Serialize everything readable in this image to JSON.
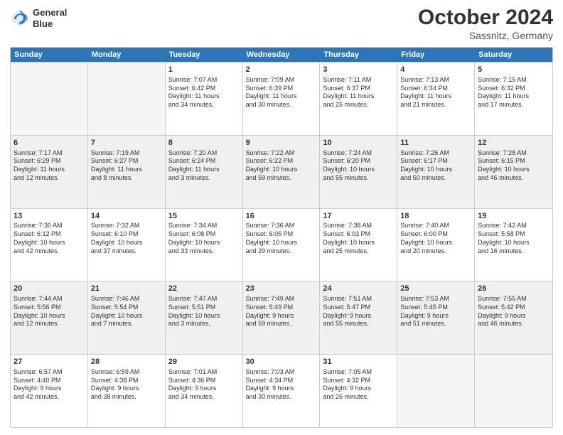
{
  "header": {
    "logo_line1": "General",
    "logo_line2": "Blue",
    "month": "October 2024",
    "location": "Sassnitz, Germany"
  },
  "weekdays": [
    "Sunday",
    "Monday",
    "Tuesday",
    "Wednesday",
    "Thursday",
    "Friday",
    "Saturday"
  ],
  "rows": [
    [
      {
        "day": "",
        "text": "",
        "empty": true
      },
      {
        "day": "",
        "text": "",
        "empty": true
      },
      {
        "day": "1",
        "text": "Sunrise: 7:07 AM\nSunset: 6:42 PM\nDaylight: 11 hours\nand 34 minutes."
      },
      {
        "day": "2",
        "text": "Sunrise: 7:09 AM\nSunset: 6:39 PM\nDaylight: 11 hours\nand 30 minutes."
      },
      {
        "day": "3",
        "text": "Sunrise: 7:11 AM\nSunset: 6:37 PM\nDaylight: 11 hours\nand 25 minutes."
      },
      {
        "day": "4",
        "text": "Sunrise: 7:13 AM\nSunset: 6:34 PM\nDaylight: 11 hours\nand 21 minutes."
      },
      {
        "day": "5",
        "text": "Sunrise: 7:15 AM\nSunset: 6:32 PM\nDaylight: 11 hours\nand 17 minutes."
      }
    ],
    [
      {
        "day": "6",
        "text": "Sunrise: 7:17 AM\nSunset: 6:29 PM\nDaylight: 11 hours\nand 12 minutes.",
        "shaded": true
      },
      {
        "day": "7",
        "text": "Sunrise: 7:19 AM\nSunset: 6:27 PM\nDaylight: 11 hours\nand 8 minutes.",
        "shaded": true
      },
      {
        "day": "8",
        "text": "Sunrise: 7:20 AM\nSunset: 6:24 PM\nDaylight: 11 hours\nand 3 minutes.",
        "shaded": true
      },
      {
        "day": "9",
        "text": "Sunrise: 7:22 AM\nSunset: 6:22 PM\nDaylight: 10 hours\nand 59 minutes.",
        "shaded": true
      },
      {
        "day": "10",
        "text": "Sunrise: 7:24 AM\nSunset: 6:20 PM\nDaylight: 10 hours\nand 55 minutes.",
        "shaded": true
      },
      {
        "day": "11",
        "text": "Sunrise: 7:26 AM\nSunset: 6:17 PM\nDaylight: 10 hours\nand 50 minutes.",
        "shaded": true
      },
      {
        "day": "12",
        "text": "Sunrise: 7:28 AM\nSunset: 6:15 PM\nDaylight: 10 hours\nand 46 minutes.",
        "shaded": true
      }
    ],
    [
      {
        "day": "13",
        "text": "Sunrise: 7:30 AM\nSunset: 6:12 PM\nDaylight: 10 hours\nand 42 minutes."
      },
      {
        "day": "14",
        "text": "Sunrise: 7:32 AM\nSunset: 6:10 PM\nDaylight: 10 hours\nand 37 minutes."
      },
      {
        "day": "15",
        "text": "Sunrise: 7:34 AM\nSunset: 6:08 PM\nDaylight: 10 hours\nand 33 minutes."
      },
      {
        "day": "16",
        "text": "Sunrise: 7:36 AM\nSunset: 6:05 PM\nDaylight: 10 hours\nand 29 minutes."
      },
      {
        "day": "17",
        "text": "Sunrise: 7:38 AM\nSunset: 6:03 PM\nDaylight: 10 hours\nand 25 minutes."
      },
      {
        "day": "18",
        "text": "Sunrise: 7:40 AM\nSunset: 6:00 PM\nDaylight: 10 hours\nand 20 minutes."
      },
      {
        "day": "19",
        "text": "Sunrise: 7:42 AM\nSunset: 5:58 PM\nDaylight: 10 hours\nand 16 minutes."
      }
    ],
    [
      {
        "day": "20",
        "text": "Sunrise: 7:44 AM\nSunset: 5:56 PM\nDaylight: 10 hours\nand 12 minutes.",
        "shaded": true
      },
      {
        "day": "21",
        "text": "Sunrise: 7:46 AM\nSunset: 5:54 PM\nDaylight: 10 hours\nand 7 minutes.",
        "shaded": true
      },
      {
        "day": "22",
        "text": "Sunrise: 7:47 AM\nSunset: 5:51 PM\nDaylight: 10 hours\nand 3 minutes.",
        "shaded": true
      },
      {
        "day": "23",
        "text": "Sunrise: 7:49 AM\nSunset: 5:49 PM\nDaylight: 9 hours\nand 59 minutes.",
        "shaded": true
      },
      {
        "day": "24",
        "text": "Sunrise: 7:51 AM\nSunset: 5:47 PM\nDaylight: 9 hours\nand 55 minutes.",
        "shaded": true
      },
      {
        "day": "25",
        "text": "Sunrise: 7:53 AM\nSunset: 5:45 PM\nDaylight: 9 hours\nand 51 minutes.",
        "shaded": true
      },
      {
        "day": "26",
        "text": "Sunrise: 7:55 AM\nSunset: 5:42 PM\nDaylight: 9 hours\nand 46 minutes.",
        "shaded": true
      }
    ],
    [
      {
        "day": "27",
        "text": "Sunrise: 6:57 AM\nSunset: 4:40 PM\nDaylight: 9 hours\nand 42 minutes."
      },
      {
        "day": "28",
        "text": "Sunrise: 6:59 AM\nSunset: 4:38 PM\nDaylight: 9 hours\nand 38 minutes."
      },
      {
        "day": "29",
        "text": "Sunrise: 7:01 AM\nSunset: 4:36 PM\nDaylight: 9 hours\nand 34 minutes."
      },
      {
        "day": "30",
        "text": "Sunrise: 7:03 AM\nSunset: 4:34 PM\nDaylight: 9 hours\nand 30 minutes."
      },
      {
        "day": "31",
        "text": "Sunrise: 7:05 AM\nSunset: 4:32 PM\nDaylight: 9 hours\nand 26 minutes."
      },
      {
        "day": "",
        "text": "",
        "empty": true
      },
      {
        "day": "",
        "text": "",
        "empty": true
      }
    ]
  ]
}
